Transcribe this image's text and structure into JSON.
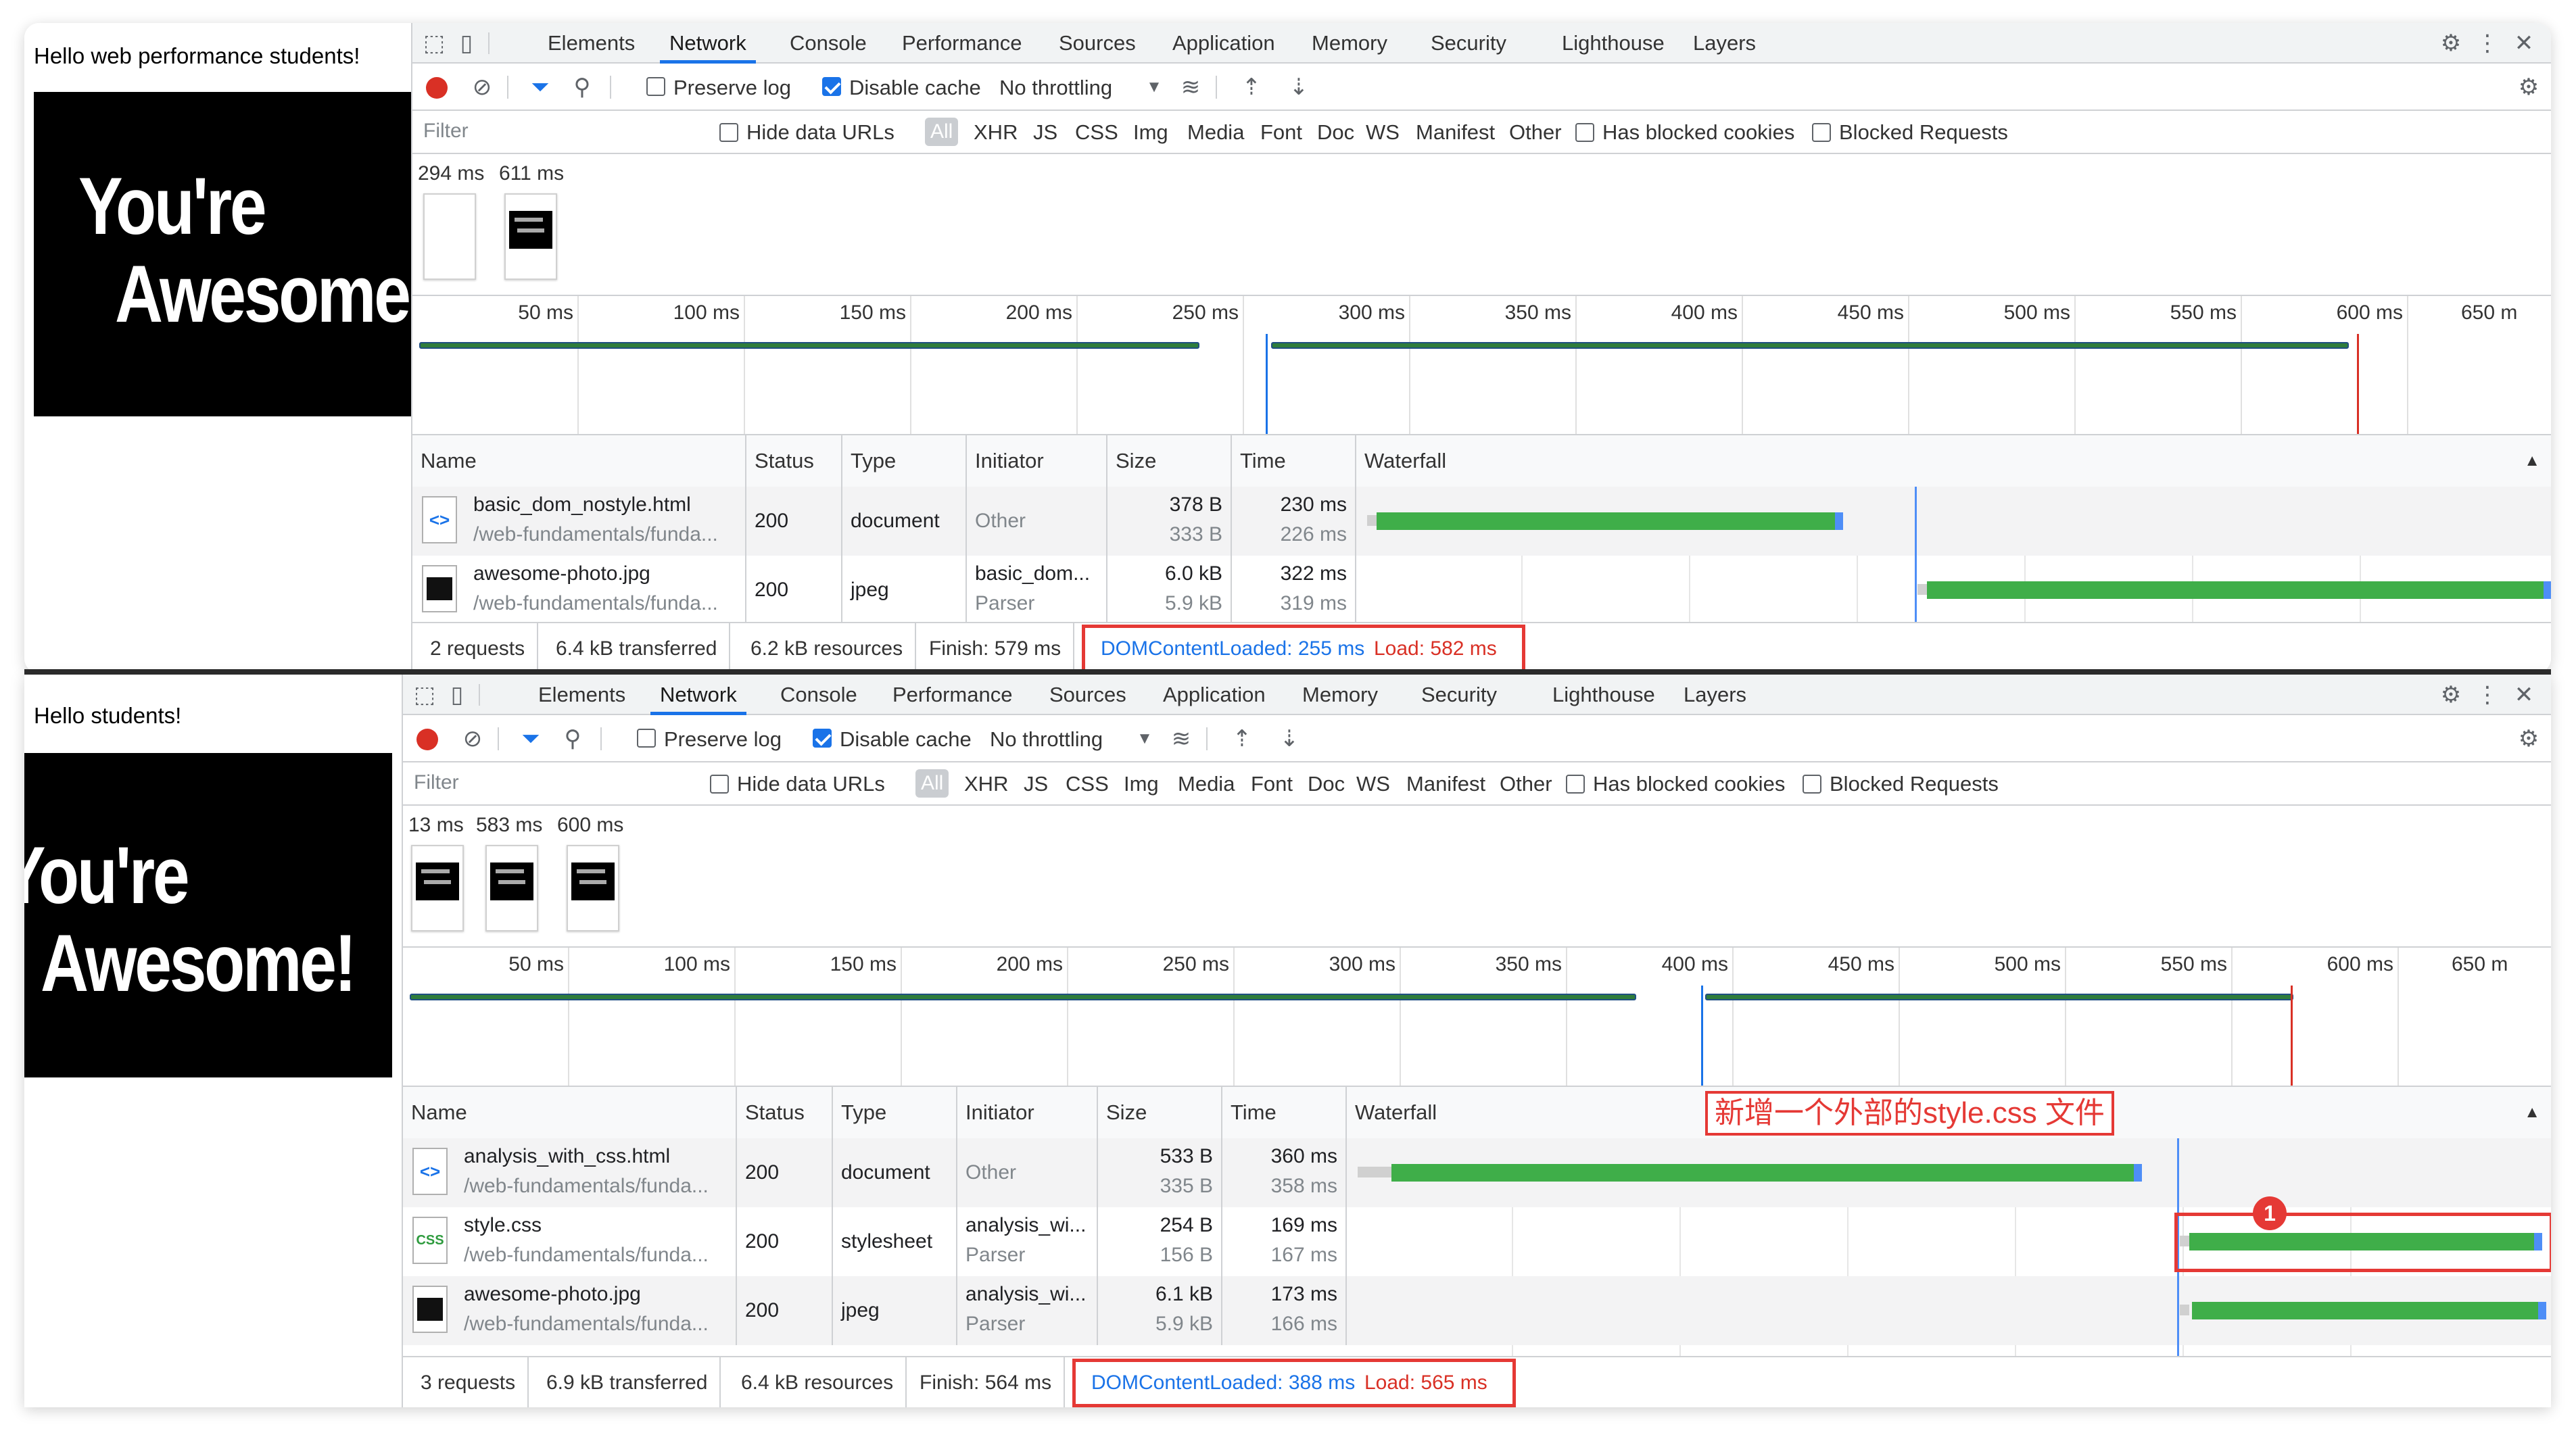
{
  "panels": [
    {
      "page_text": "Hello web performance students!",
      "hero": {
        "line1": "You're",
        "line2": "Awesome!"
      },
      "tabs": [
        "Elements",
        "Network",
        "Console",
        "Performance",
        "Sources",
        "Application",
        "Memory",
        "Security",
        "Lighthouse",
        "Layers"
      ],
      "active_tab": "Network",
      "toolbar": {
        "preserve_log": "Preserve log",
        "disable_cache": "Disable cache",
        "throttling": "No throttling"
      },
      "filter": {
        "placeholder": "Filter",
        "hide_data_urls": "Hide data URLs",
        "all": "All",
        "types": [
          "XHR",
          "JS",
          "CSS",
          "Img",
          "Media",
          "Font",
          "Doc",
          "WS",
          "Manifest",
          "Other"
        ],
        "blocked_cookies": "Has blocked cookies",
        "blocked_requests": "Blocked Requests"
      },
      "screenshots": [
        "294 ms",
        "611 ms"
      ],
      "overview_ticks": [
        "50 ms",
        "100 ms",
        "150 ms",
        "200 ms",
        "250 ms",
        "300 ms",
        "350 ms",
        "400 ms",
        "450 ms",
        "500 ms",
        "550 ms",
        "600 ms",
        "650 m"
      ],
      "columns": [
        "Name",
        "Status",
        "Type",
        "Initiator",
        "Size",
        "Time",
        "Waterfall"
      ],
      "rows": [
        {
          "name": "basic_dom_nostyle.html",
          "path": "/web-fundamentals/funda...",
          "status": "200",
          "type": "document",
          "initiator": "Other",
          "initiator2": "",
          "size1": "378 B",
          "size2": "333 B",
          "time1": "230 ms",
          "time2": "226 ms",
          "icon": "html"
        },
        {
          "name": "awesome-photo.jpg",
          "path": "/web-fundamentals/funda...",
          "status": "200",
          "type": "jpeg",
          "initiator": "basic_dom...",
          "initiator2": "Parser",
          "size1": "6.0 kB",
          "size2": "5.9 kB",
          "time1": "322 ms",
          "time2": "319 ms",
          "icon": "img"
        }
      ],
      "status": {
        "requests": "2 requests",
        "transferred": "6.4 kB transferred",
        "resources": "6.2 kB resources",
        "finish": "Finish: 579 ms",
        "dcl": "DOMContentLoaded: 255 ms",
        "load": "Load: 582 ms"
      }
    },
    {
      "page_text": "Hello students!",
      "hero": {
        "line1": "You're",
        "line2": "Awesome!"
      },
      "tabs": [
        "Elements",
        "Network",
        "Console",
        "Performance",
        "Sources",
        "Application",
        "Memory",
        "Security",
        "Lighthouse",
        "Layers"
      ],
      "active_tab": "Network",
      "toolbar": {
        "preserve_log": "Preserve log",
        "disable_cache": "Disable cache",
        "throttling": "No throttling"
      },
      "filter": {
        "placeholder": "Filter",
        "hide_data_urls": "Hide data URLs",
        "all": "All",
        "types": [
          "XHR",
          "JS",
          "CSS",
          "Img",
          "Media",
          "Font",
          "Doc",
          "WS",
          "Manifest",
          "Other"
        ],
        "blocked_cookies": "Has blocked cookies",
        "blocked_requests": "Blocked Requests"
      },
      "screenshots": [
        "13 ms",
        "583 ms",
        "600 ms"
      ],
      "overview_ticks": [
        "50 ms",
        "100 ms",
        "150 ms",
        "200 ms",
        "250 ms",
        "300 ms",
        "350 ms",
        "400 ms",
        "450 ms",
        "500 ms",
        "550 ms",
        "600 ms",
        "650 m"
      ],
      "columns": [
        "Name",
        "Status",
        "Type",
        "Initiator",
        "Size",
        "Time",
        "Waterfall"
      ],
      "rows": [
        {
          "name": "analysis_with_css.html",
          "path": "/web-fundamentals/funda...",
          "status": "200",
          "type": "document",
          "initiator": "Other",
          "initiator2": "",
          "size1": "533 B",
          "size2": "335 B",
          "time1": "360 ms",
          "time2": "358 ms",
          "icon": "html"
        },
        {
          "name": "style.css",
          "path": "/web-fundamentals/funda...",
          "status": "200",
          "type": "stylesheet",
          "initiator": "analysis_wi...",
          "initiator2": "Parser",
          "size1": "254 B",
          "size2": "156 B",
          "time1": "169 ms",
          "time2": "167 ms",
          "icon": "css"
        },
        {
          "name": "awesome-photo.jpg",
          "path": "/web-fundamentals/funda...",
          "status": "200",
          "type": "jpeg",
          "initiator": "analysis_wi...",
          "initiator2": "Parser",
          "size1": "6.1 kB",
          "size2": "5.9 kB",
          "time1": "173 ms",
          "time2": "166 ms",
          "icon": "img"
        }
      ],
      "status": {
        "requests": "3 requests",
        "transferred": "6.9 kB transferred",
        "resources": "6.4 kB resources",
        "finish": "Finish: 564 ms",
        "dcl": "DOMContentLoaded: 388 ms",
        "load": "Load: 565 ms"
      },
      "annotation": {
        "callout": "新增一个外部的style.css 文件",
        "badge": "1"
      }
    }
  ],
  "colors": {
    "accent": "#1a73e8",
    "record": "#d93025",
    "dcl": "#1a73e8",
    "load": "#d93025",
    "waterfall": "#3fae49",
    "annotation": "#e53935"
  }
}
